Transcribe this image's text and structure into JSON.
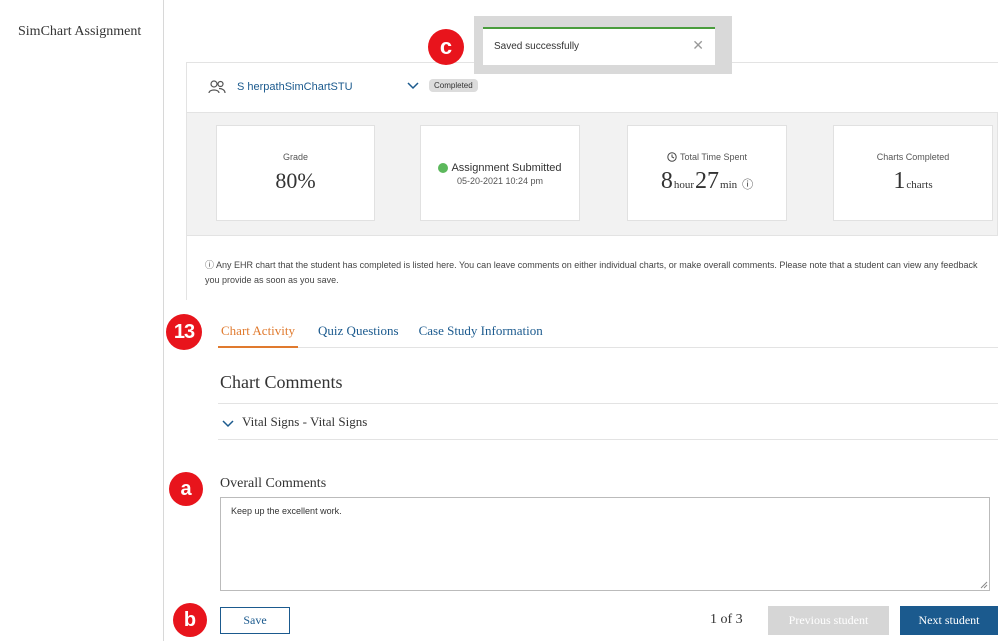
{
  "app": {
    "title": "SimChart Assignment"
  },
  "student": {
    "name": "S herpathSimChartSTU",
    "status_badge": "Completed",
    "icon": "people-icon"
  },
  "summary": {
    "grade": {
      "label": "Grade",
      "value": "80%"
    },
    "submission": {
      "status": "Assignment Submitted",
      "date": "05-20-2021 10:24 pm",
      "status_color": "#5cb85c"
    },
    "time_spent": {
      "label": "Total Time Spent",
      "hours": "8",
      "hours_unit": "hour",
      "minutes": "27",
      "minutes_unit": "min",
      "info_glyph": "ⓘ"
    },
    "charts_completed": {
      "label": "Charts Completed",
      "value": "1",
      "unit": "charts"
    }
  },
  "info": {
    "glyph": "ⓘ",
    "text": "Any EHR chart that the student has completed is listed here. You can leave comments on either individual charts, or make overall comments. Please note that a student can view any feedback you provide as soon as you save."
  },
  "toast": {
    "message": "Saved successfully",
    "close_glyph": "✕",
    "accent": "#4a9d3d"
  },
  "annotations": {
    "c": "c",
    "n13": "13",
    "a": "a",
    "b": "b"
  },
  "tabs": [
    {
      "label": "Chart Activity",
      "active": true
    },
    {
      "label": "Quiz Questions",
      "active": false
    },
    {
      "label": "Case Study Information",
      "active": false
    }
  ],
  "chart_comments": {
    "title": "Chart Comments",
    "items": [
      {
        "label": "Vital Signs - Vital Signs"
      }
    ]
  },
  "overall_comments": {
    "label": "Overall Comments",
    "value": "Keep up the excellent work."
  },
  "footer": {
    "save_label": "Save",
    "pager": "1 of 3",
    "previous_label": "Previous student",
    "next_label": "Next student"
  },
  "colors": {
    "link": "#1b5a8e",
    "active_tab": "#e07a2e",
    "marker": "#e8141c"
  }
}
